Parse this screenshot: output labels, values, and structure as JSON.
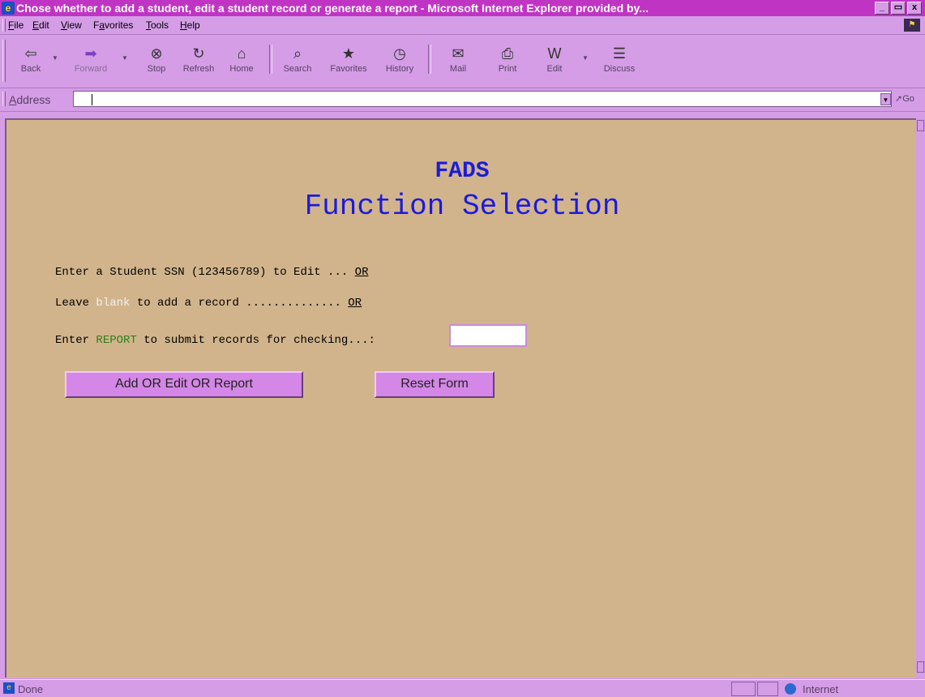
{
  "window": {
    "title": "Chose whether to add a student, edit a student record or generate a report - Microsoft Internet Explorer provided by...",
    "title_icon": "ie-icon",
    "controls": [
      "_",
      "▭",
      "x"
    ]
  },
  "menubar": {
    "items": [
      {
        "label": "File",
        "accel": "F",
        "rest": "ile"
      },
      {
        "label": "Edit",
        "accel": "E",
        "rest": "dit"
      },
      {
        "label": "View",
        "accel": "V",
        "rest": "iew"
      },
      {
        "label": "Favorites",
        "prefix": "F",
        "accel": "a",
        "rest": "vorites"
      },
      {
        "label": "Tools",
        "accel": "T",
        "rest": "ools"
      },
      {
        "label": "Help",
        "accel": "H",
        "rest": "elp"
      }
    ]
  },
  "toolbar": {
    "back": "Back",
    "forward": "Forward",
    "stop": "Stop",
    "refresh": "Refresh",
    "home": "Home",
    "search": "Search",
    "favorites": "Favorites",
    "history": "History",
    "mail": "Mail",
    "print": "Print",
    "edit": "Edit",
    "discuss": "Discuss"
  },
  "address": {
    "label_accel": "A",
    "label_rest": "ddress",
    "value": "",
    "go": "Go"
  },
  "page": {
    "heading1": "FADS",
    "heading2": "Function Selection",
    "line1_text": "Enter a Student SSN (123456789) to Edit ... ",
    "line1_or": "OR",
    "line2_pre": "Leave ",
    "line2_blank": "blank",
    "line2_post": " to add a record .............. ",
    "line2_or": "OR",
    "line3_pre": "Enter ",
    "line3_report": "REPORT",
    "line3_post": " to submit records for checking...: ",
    "report_field_value": "",
    "submit_label": "Add OR Edit OR Report",
    "reset_label": "Reset Form"
  },
  "status": {
    "text": "Done",
    "zone": "Internet"
  },
  "colors": {
    "chrome": "#d49de6",
    "titlebar": "#c034c4",
    "page_bg": "#d2b48c",
    "heading": "#1b1bdc",
    "report_word": "#2e7d1a",
    "blank_word": "#f0f0f0",
    "button_face": "#d487e6"
  }
}
